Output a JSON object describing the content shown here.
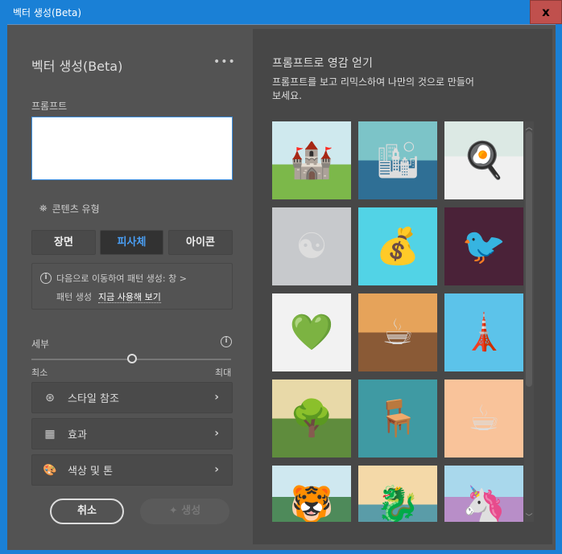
{
  "window": {
    "title": "벡터 생성(Beta)",
    "close_label": "x"
  },
  "left": {
    "title": "벡터 생성(Beta)",
    "more_label": "•••",
    "prompt_label": "프롬프트",
    "prompt_value": "",
    "content_type_label": "콘텐츠 유형",
    "content_types": [
      {
        "label": "장면",
        "active": false
      },
      {
        "label": "피사체",
        "active": true
      },
      {
        "label": "아이콘",
        "active": false
      }
    ],
    "info": {
      "line1": "다음으로 이동하여 패턴 생성: 창 >",
      "line2": "패턴 생성",
      "link": "지금 사용해 보기"
    },
    "detail": {
      "label": "세부",
      "min_label": "최소",
      "max_label": "최대",
      "value": 0.5
    },
    "rows": [
      {
        "label": "스타일 참조",
        "icon": "style-reference-icon"
      },
      {
        "label": "효과",
        "icon": "effects-icon"
      },
      {
        "label": "색상 및 톤",
        "icon": "palette-icon"
      }
    ],
    "cancel_label": "취소",
    "generate_label": "생성"
  },
  "right": {
    "title": "프롬프트로 영감 얻기",
    "description": "프롬프트를 보고 리믹스하여 나만의 것으로 만들어 보세요.",
    "scroll_position": 0
  }
}
